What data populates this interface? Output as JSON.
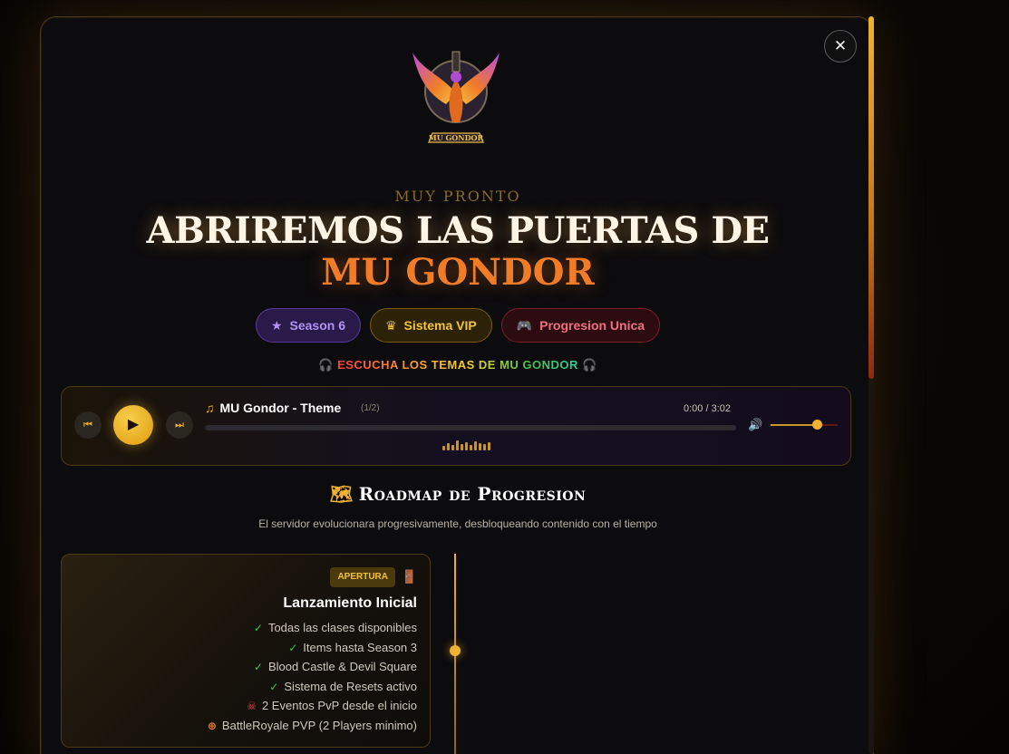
{
  "modal": {
    "close_label": "✕"
  },
  "hero": {
    "eyebrow": "MUY PRONTO",
    "title_line1": "ABRIREMOS LAS PUERTAS DE",
    "title_line2": "MU GONDOR",
    "logo_text": "MU GONDOR"
  },
  "badges": [
    {
      "label": "Season 6",
      "icon": "star-icon",
      "color": "#b392f5"
    },
    {
      "label": "Sistema VIP",
      "icon": "crown-icon",
      "color": "#f3c33a"
    },
    {
      "label": "Progresion Unica",
      "icon": "gamepad-icon",
      "color": "#f07080"
    }
  ],
  "listen": {
    "text": "ESCUCHA LOS TEMAS DE MU GONDOR"
  },
  "player": {
    "track_title": "MU Gondor - Theme",
    "track_count": "(1/2)",
    "time": "0:00 / 3:02",
    "progress": 0,
    "volume": 0.7,
    "accent": "#f0b232"
  },
  "roadmap": {
    "title": "Roadmap de Progresion",
    "subtitle": "El servidor evolucionara progresivamente, desbloqueando contenido con el tiempo",
    "cards": [
      {
        "tag": "APERTURA",
        "title": "Lanzamiento Inicial",
        "features": [
          {
            "text": "Todas las clases disponibles",
            "icon": "check-icon",
            "color": "#3ac45a"
          },
          {
            "text": "Items hasta Season 3",
            "icon": "check-icon",
            "color": "#3ac45a"
          },
          {
            "text": "Blood Castle & Devil Square",
            "icon": "check-icon",
            "color": "#3ac45a"
          },
          {
            "text": "Sistema de Resets activo",
            "icon": "check-icon",
            "color": "#3ac45a"
          },
          {
            "text": "2 Eventos PvP desde el inicio",
            "icon": "skull-icon",
            "color": "#e84a4a"
          },
          {
            "text": "BattleRoyale PVP (2 Players minimo)",
            "icon": "crosshair-icon",
            "color": "#f07c28"
          }
        ]
      }
    ]
  }
}
